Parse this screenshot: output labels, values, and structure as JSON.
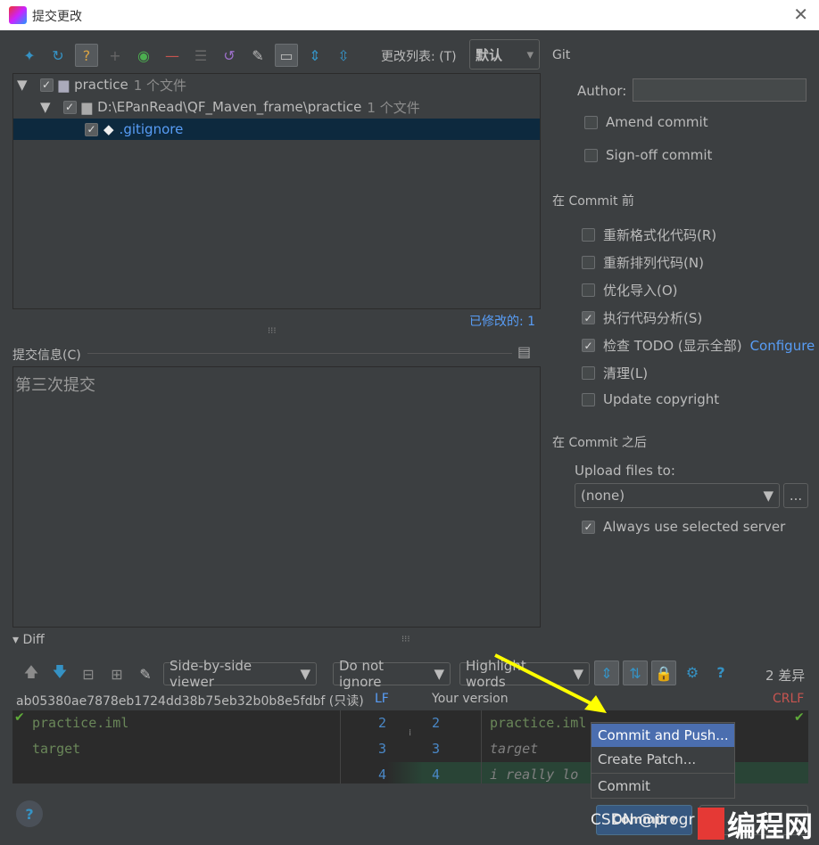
{
  "window": {
    "title": "提交更改"
  },
  "toolbar": {
    "changelist_label": "更改列表: (T)",
    "changelist_value": "默认"
  },
  "tree": {
    "root": {
      "name": "practice",
      "count": "1 个文件"
    },
    "dir": {
      "name": "D:\\EPanRead\\QF_Maven_frame\\practice",
      "count": "1 个文件"
    },
    "file": {
      "name": ".gitignore"
    },
    "modified": "已修改的: 1"
  },
  "commit_message": {
    "label": "提交信息(C)",
    "value": "第三次提交"
  },
  "git": {
    "title": "Git",
    "author_label": "Author:",
    "author_value": "",
    "amend": "Amend commit",
    "signoff": "Sign-off commit",
    "before_title": "在 Commit 前",
    "before_options": [
      {
        "label": "重新格式化代码(R)",
        "checked": false
      },
      {
        "label": "重新排列代码(N)",
        "checked": false
      },
      {
        "label": "优化导入(O)",
        "checked": false
      },
      {
        "label": "执行代码分析(S)",
        "checked": true
      },
      {
        "label": "检查 TODO (显示全部)",
        "checked": true
      },
      {
        "label": "清理(L)",
        "checked": false
      },
      {
        "label": "Update copyright",
        "checked": false
      }
    ],
    "configure": "Configure",
    "after_title": "在 Commit 之后",
    "upload_label": "Upload files to:",
    "upload_value": "(none)",
    "more": "...",
    "always_use": "Always use selected server"
  },
  "diff": {
    "title": "Diff",
    "viewer": "Side-by-side viewer",
    "ignore": "Do not ignore",
    "highlight": "Highlight words",
    "diff_count": "2 差异",
    "left_title": "ab05380ae7878eb1724dd38b75eb32b0b8e5fdbf (只读)",
    "left_sep": "LF",
    "right_title": "Your version",
    "right_sep": "CRLF",
    "left_lines": [
      {
        "n": "2",
        "text": "practice.iml"
      },
      {
        "n": "3",
        "text": "target"
      },
      {
        "n": "4",
        "text": ""
      }
    ],
    "right_lines": [
      {
        "n": "2",
        "text": "practice.iml"
      },
      {
        "n": "3",
        "text": "target"
      },
      {
        "n": "4",
        "text": "i really lo"
      }
    ]
  },
  "menu": {
    "items": [
      "Commit and Push...",
      "Create Patch...",
      "Commit"
    ]
  },
  "buttons": {
    "commit": "Commit ▾",
    "help": "?"
  },
  "watermark": "CSDN @progr",
  "colors": {
    "accent": "#4b6eaf",
    "selection": "#0d293e",
    "link": "#589df6",
    "added": "#294436"
  }
}
